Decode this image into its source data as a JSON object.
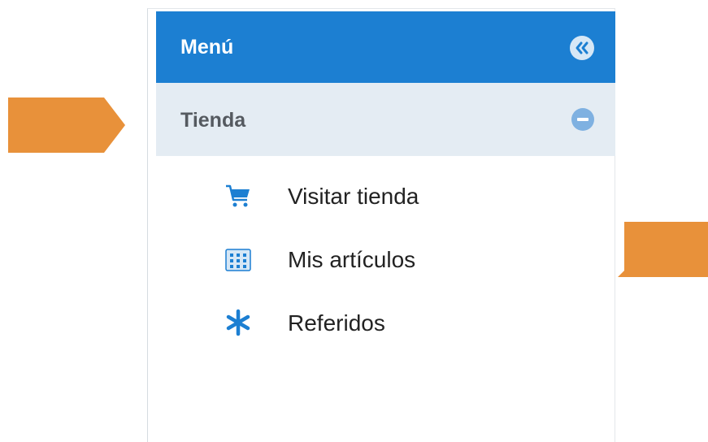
{
  "menu": {
    "title": "Menú",
    "collapse_icon": "double-chevron-left-icon"
  },
  "section": {
    "title": "Tienda",
    "toggle_icon": "minus-circle-icon"
  },
  "items": [
    {
      "label": "Visitar tienda",
      "icon": "cart-icon"
    },
    {
      "label": "Mis artículos",
      "icon": "grid-icon"
    },
    {
      "label": "Referidos",
      "icon": "asterisk-icon"
    }
  ],
  "colors": {
    "header_blue": "#1c7fd2",
    "section_bg": "#e4ecf3",
    "arrow_orange": "#e8913a",
    "icon_blue": "#1c7fd2"
  }
}
